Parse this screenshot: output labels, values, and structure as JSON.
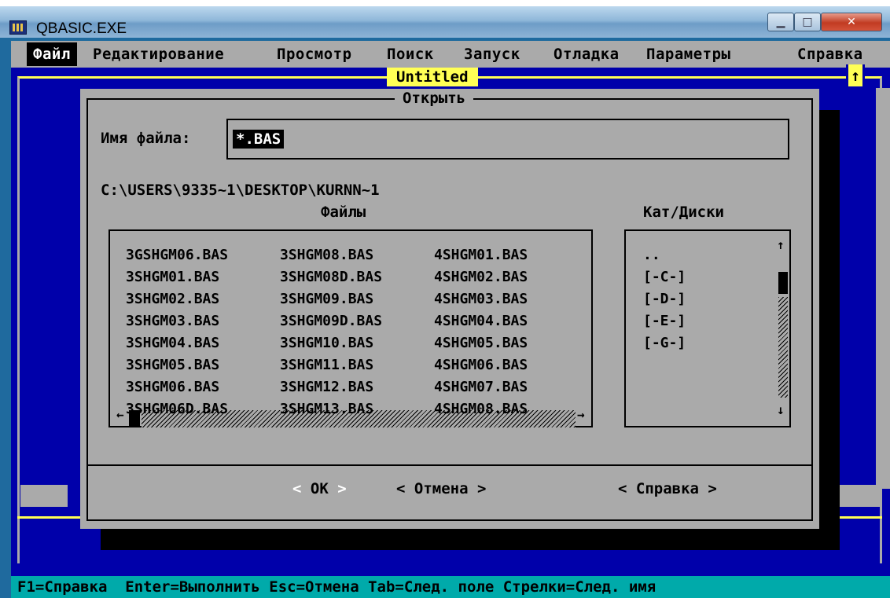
{
  "window": {
    "title": "QBASIC.EXE"
  },
  "menu": {
    "items": [
      {
        "label": "Файл",
        "active": true
      },
      {
        "label": "Редактирование",
        "active": false
      },
      {
        "label": "Просмотр",
        "active": false
      },
      {
        "label": "Поиск",
        "active": false
      },
      {
        "label": "Запуск",
        "active": false
      },
      {
        "label": "Отладка",
        "active": false
      },
      {
        "label": "Параметры",
        "active": false
      },
      {
        "label": "Справка",
        "active": false
      }
    ]
  },
  "editor": {
    "doc_title": "Untitled"
  },
  "dialog": {
    "title": "Открыть",
    "filename_label": "Имя файла:",
    "filename_value": "*.BAS",
    "path": "C:\\USERS\\9335~1\\DESKTOP\\KURNN~1",
    "files_header": "Файлы",
    "dirs_header": "Кат/Диски",
    "files": [
      [
        "3GSHGM06.BAS",
        "3SHGM08.BAS",
        "4SHGM01.BAS"
      ],
      [
        "3SHGM01.BAS",
        "3SHGM08D.BAS",
        "4SHGM02.BAS"
      ],
      [
        "3SHGM02.BAS",
        "3SHGM09.BAS",
        "4SHGM03.BAS"
      ],
      [
        "3SHGM03.BAS",
        "3SHGM09D.BAS",
        "4SHGM04.BAS"
      ],
      [
        "3SHGM04.BAS",
        "3SHGM10.BAS",
        "4SHGM05.BAS"
      ],
      [
        "3SHGM05.BAS",
        "3SHGM11.BAS",
        "4SHGM06.BAS"
      ],
      [
        "3SHGM06.BAS",
        "3SHGM12.BAS",
        "4SHGM07.BAS"
      ],
      [
        "3SHGM06D.BAS",
        "3SHGM13.BAS",
        "4SHGM08.BAS"
      ]
    ],
    "dirs": [
      "..",
      "[-C-]",
      "[-D-]",
      "[-E-]",
      "[-G-]"
    ],
    "buttons": {
      "ok": "OK",
      "cancel": "< Отмена >",
      "help": "< Справка >"
    }
  },
  "statusbar": {
    "text": "F1=Справка  Enter=Выполнить Esc=Отмена Tab=След. поле Стрелки=След. имя"
  },
  "colors": {
    "background": "#0000aa",
    "dialog": "#aaaaaa",
    "highlight": "#ffff55",
    "status": "#00aaaa"
  }
}
